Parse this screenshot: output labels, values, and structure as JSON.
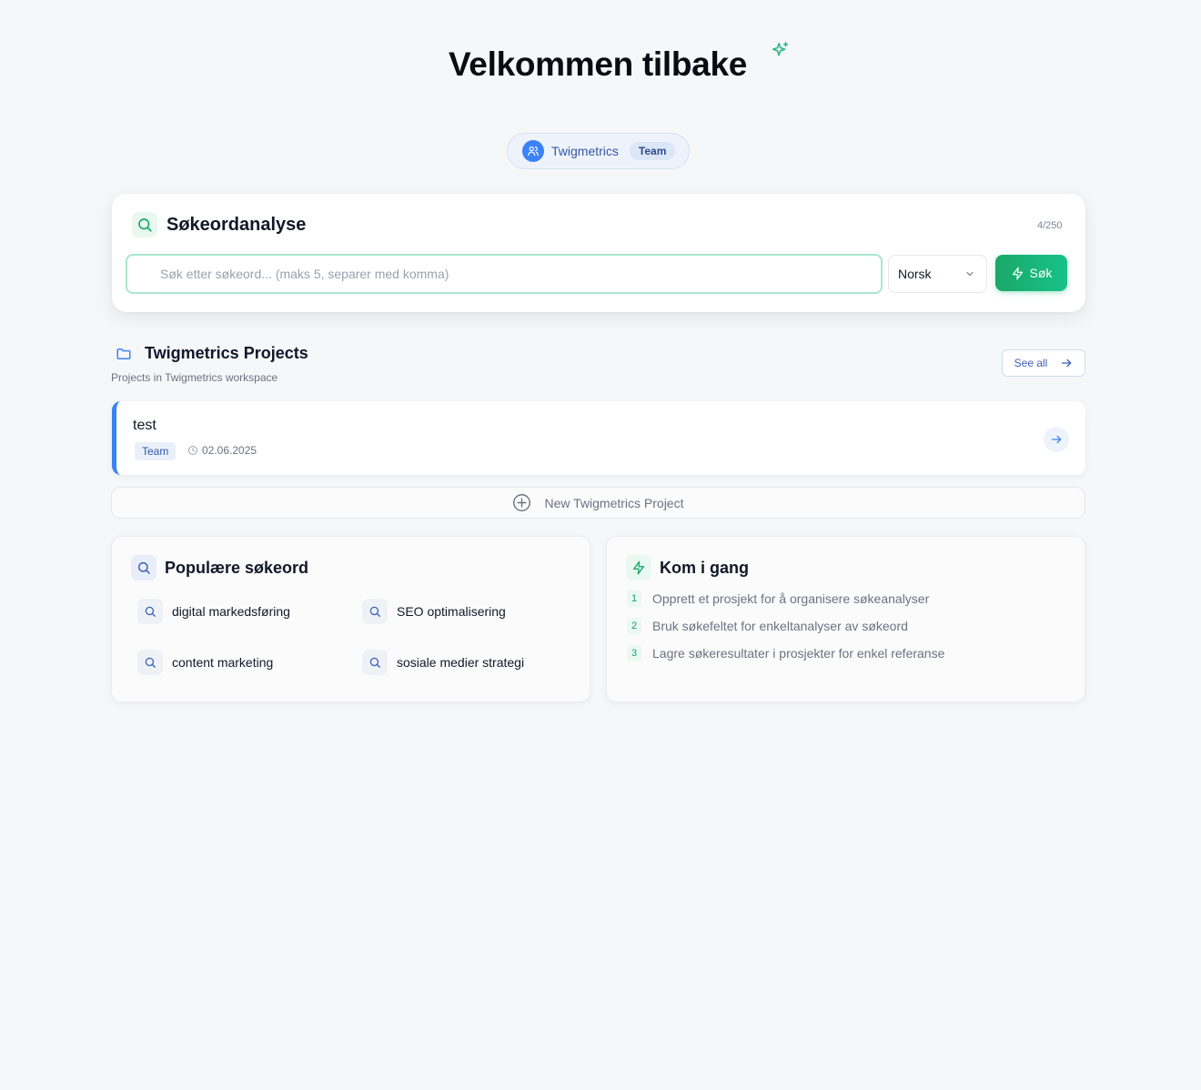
{
  "header": {
    "title": "Velkommen tilbake",
    "workspace_name": "Twigmetrics",
    "workspace_badge": "Team"
  },
  "search": {
    "title": "Søkeordanalyse",
    "counter": "4/250",
    "placeholder": "Søk etter søkeord... (maks 5, separer med komma)",
    "value": "",
    "language": "Norsk",
    "button_label": "Søk"
  },
  "projects": {
    "title": "Twigmetrics Projects",
    "subtitle": "Projects in Twigmetrics workspace",
    "see_all_label": "See all",
    "items": [
      {
        "name": "test",
        "badge": "Team",
        "date": "02.06.2025"
      }
    ],
    "new_project_label": "New Twigmetrics Project"
  },
  "popular": {
    "title": "Populære søkeord",
    "keywords": [
      "digital markedsføring",
      "SEO optimalisering",
      "content marketing",
      "sosiale medier strategi"
    ]
  },
  "getting_started": {
    "title": "Kom i gang",
    "steps": [
      {
        "num": "1",
        "text": "Opprett et prosjekt for å organisere søkeanalyser"
      },
      {
        "num": "2",
        "text": "Bruk søkefeltet for enkeltanalyser av søkeord"
      },
      {
        "num": "3",
        "text": "Lagre søkeresultater i prosjekter for enkel referanse"
      }
    ]
  },
  "colors": {
    "accent_green": "#1aa866",
    "accent_blue": "#3b82f6"
  }
}
